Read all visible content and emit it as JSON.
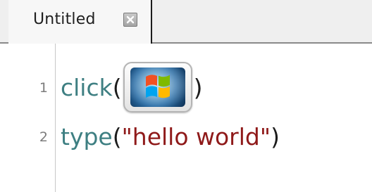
{
  "tab": {
    "title": "Untitled"
  },
  "editor": {
    "line_numbers": [
      "1",
      "2"
    ],
    "line1": {
      "function": "click",
      "open_paren": "(",
      "close_paren": ")",
      "image_icon": "windows-logo-icon"
    },
    "line2": {
      "function": "type",
      "open_paren": "(",
      "argument": "\"hello world\"",
      "close_paren": ")"
    }
  },
  "colors": {
    "function": "#3e7f82",
    "string": "#8f1a1a",
    "line_number": "#7c7c7c",
    "tab_background": "#efefef"
  }
}
